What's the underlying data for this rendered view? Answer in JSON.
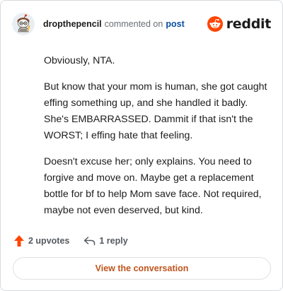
{
  "header": {
    "username": "dropthepencil",
    "action_text": "commented on",
    "post_link": "post",
    "brand_name": "reddit",
    "brand_color": "#ff4500"
  },
  "comment": {
    "paragraphs": [
      "Obviously, NTA.",
      "But know that your mom is human, she got caught effing something up, and she handled it badly. She's EMBARRASSED. Dammit if that isn't the WORST; I effing hate that feeling.",
      "Doesn't excuse her; only explains. You need to forgive and move on. Maybe get a replacement bottle for bf to help Mom save face. Not required, maybe not even deserved, but kind."
    ]
  },
  "actions": {
    "upvotes_label": "2 upvotes",
    "upvote_icon": "upvote-arrow-icon",
    "upvote_color": "#ff4500",
    "reply_label": "1 reply",
    "reply_icon": "reply-arrow-icon"
  },
  "footer": {
    "view_conversation_label": "View the conversation",
    "link_color": "#c0541c"
  }
}
